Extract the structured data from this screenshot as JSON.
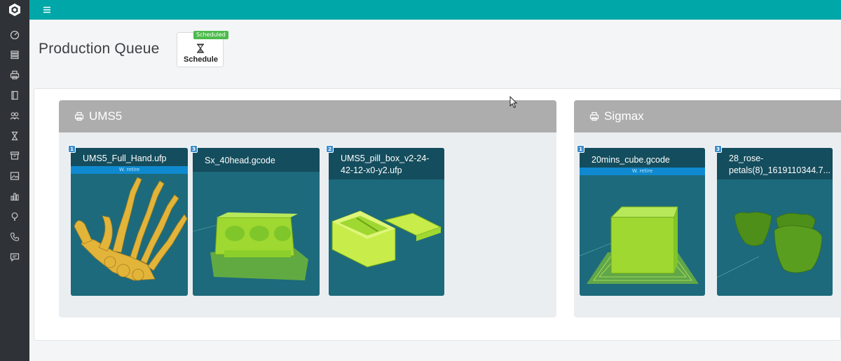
{
  "topbar": {
    "menu_icon": "hamburger-icon"
  },
  "sidebar": {
    "logo_icon": "app-logo-icon",
    "items": [
      {
        "icon": "dashboard-icon"
      },
      {
        "icon": "queue-icon"
      },
      {
        "icon": "printer-icon"
      },
      {
        "icon": "book-icon"
      },
      {
        "icon": "users-icon"
      },
      {
        "icon": "hourglass-icon"
      },
      {
        "icon": "archive-icon"
      },
      {
        "icon": "image-icon"
      },
      {
        "icon": "bar-chart-icon"
      },
      {
        "icon": "lightbulb-icon"
      },
      {
        "icon": "phone-icon"
      },
      {
        "icon": "chat-icon"
      }
    ]
  },
  "header": {
    "title": "Production Queue",
    "schedule": {
      "badge": "Scheduled",
      "label": "Schedule",
      "icon": "hourglass-icon"
    }
  },
  "printers": [
    {
      "name": "UMS5",
      "icon": "printer-icon",
      "jobs": [
        {
          "badge": "1",
          "file": "UMS5_Full_Hand.ufp",
          "tag": "W. retire",
          "thumb": "hand-model"
        },
        {
          "badge": "3",
          "file": "Sx_40head.gcode",
          "tag": "",
          "thumb": "tray-model"
        },
        {
          "badge": "2",
          "file": "UMS5_pill_box_v2-24-42-12-x0-y2.ufp",
          "tag": "",
          "thumb": "pillbox-model"
        }
      ]
    },
    {
      "name": "Sigmax",
      "icon": "printer-icon",
      "jobs": [
        {
          "badge": "1",
          "file": "20mins_cube.gcode",
          "tag": "W. retire",
          "thumb": "cube-model"
        },
        {
          "badge": "3",
          "file": "28_rose-petals(8)_1619110344.7...",
          "tag": "",
          "thumb": "rose-model"
        }
      ]
    }
  ],
  "colors": {
    "topbar": "#00a7a8",
    "sidebar": "#2f3236",
    "card": "#1d6a7c",
    "card_title": "#144d5d",
    "tag": "#0f8ad0",
    "badge_green": "#4dbb4d",
    "model_yellow": "#e6b93a",
    "model_green": "#9fd830"
  }
}
